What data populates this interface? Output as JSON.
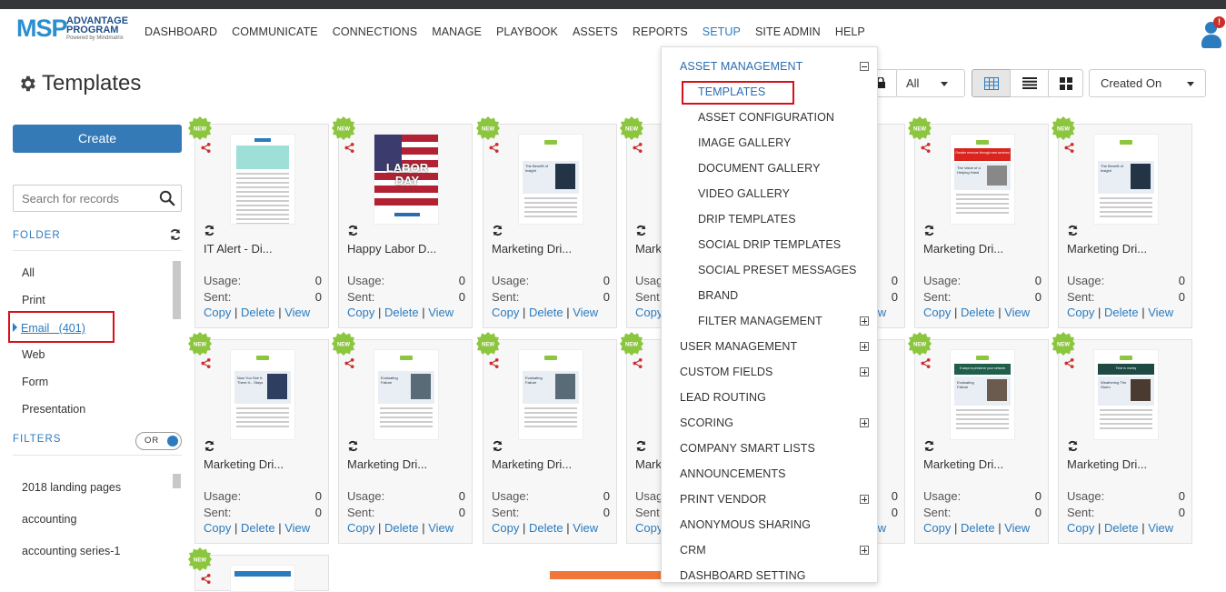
{
  "nav": {
    "logo": {
      "brand": "MSP",
      "line1": "ADVANTAGE",
      "line2": "PROGRAM",
      "powered": "Powered by Mindmatrix"
    },
    "items": [
      "DASHBOARD",
      "COMMUNICATE",
      "CONNECTIONS",
      "MANAGE",
      "PLAYBOOK",
      "ASSETS",
      "REPORTS",
      "SETUP",
      "SITE ADMIN",
      "HELP"
    ],
    "active": "SETUP",
    "notification_badge": "!"
  },
  "page": {
    "title": "Templates"
  },
  "sidebar": {
    "create_label": "Create",
    "search_placeholder": "Search for records",
    "folder_heading": "FOLDER",
    "folders": [
      "All",
      "Print",
      "Email   (401)",
      "Web",
      "Form",
      "Presentation"
    ],
    "selected_folder": "Email   (401)",
    "filters_heading": "FILTERS",
    "filter_mode": "OR",
    "filters": [
      "2018 landing pages",
      "accounting",
      "accounting series-1"
    ]
  },
  "controls": {
    "filter_value": "All",
    "sort_value": "Created On"
  },
  "cards": [
    {
      "name": "IT Alert - Di...",
      "usage_label": "Usage:",
      "usage": "0",
      "sent_label": "Sent:",
      "sent": "0"
    },
    {
      "name": "Happy Labor D...",
      "usage_label": "Usage:",
      "usage": "0",
      "sent_label": "Sent:",
      "sent": "0"
    },
    {
      "name": "Marketing Dri...",
      "usage_label": "Usage:",
      "usage": "0",
      "sent_label": "Sent:",
      "sent": "0"
    },
    {
      "name": "Mark",
      "usage_label": "Usag",
      "usage": "",
      "sent_label": "Sent",
      "sent": ""
    },
    {
      "name": "",
      "usage_label": "",
      "usage": "0",
      "sent_label": "",
      "sent": "0"
    },
    {
      "name": "Marketing Dri...",
      "usage_label": "Usage:",
      "usage": "0",
      "sent_label": "Sent:",
      "sent": "0"
    },
    {
      "name": "Marketing Dri...",
      "usage_label": "Usage:",
      "usage": "0",
      "sent_label": "Sent:",
      "sent": "0"
    },
    {
      "name": "Marketing Dri...",
      "usage_label": "Usage:",
      "usage": "0",
      "sent_label": "Sent:",
      "sent": "0"
    },
    {
      "name": "Marketing Dri...",
      "usage_label": "Usage:",
      "usage": "0",
      "sent_label": "Sent:",
      "sent": "0"
    },
    {
      "name": "Marketing Dri...",
      "usage_label": "Usage:",
      "usage": "0",
      "sent_label": "Sent:",
      "sent": "0"
    },
    {
      "name": "Mark",
      "usage_label": "Usag",
      "usage": "",
      "sent_label": "Sent",
      "sent": ""
    },
    {
      "name": "",
      "usage_label": "",
      "usage": "0",
      "sent_label": "",
      "sent": "0"
    },
    {
      "name": "Marketing Dri...",
      "usage_label": "Usage:",
      "usage": "0",
      "sent_label": "Sent:",
      "sent": "0"
    },
    {
      "name": "Marketing Dri...",
      "usage_label": "Usage:",
      "usage": "0",
      "sent_label": "Sent:",
      "sent": "0"
    }
  ],
  "card_links": {
    "copy": "Copy",
    "delete": "Delete",
    "view": "View",
    "sep": "|"
  },
  "new_badge": "NEW",
  "thumbnails": {
    "labor_day": "LABOR DAY",
    "benefit": "The Benefit of Insight",
    "value": "The Value of a Helping Hand",
    "greater": "Greater revenue through new services",
    "now_you": "Now You See It. There It... Stays",
    "evaluating": "Evaluating Failure",
    "ways": "5 ways to preserve your network",
    "time": "Time is money",
    "weathering": "Weathering The Storm"
  },
  "setup_menu": [
    {
      "label": "ASSET MANAGEMENT",
      "level": "head",
      "toggle": "minus"
    },
    {
      "label": "TEMPLATES",
      "level": "sub",
      "selected": true
    },
    {
      "label": "ASSET CONFIGURATION",
      "level": "sub"
    },
    {
      "label": "IMAGE GALLERY",
      "level": "sub"
    },
    {
      "label": "DOCUMENT GALLERY",
      "level": "sub"
    },
    {
      "label": "VIDEO GALLERY",
      "level": "sub"
    },
    {
      "label": "DRIP TEMPLATES",
      "level": "sub"
    },
    {
      "label": "SOCIAL DRIP TEMPLATES",
      "level": "sub"
    },
    {
      "label": "SOCIAL PRESET MESSAGES",
      "level": "sub"
    },
    {
      "label": "BRAND",
      "level": "sub"
    },
    {
      "label": "FILTER MANAGEMENT",
      "level": "sub",
      "toggle": "plus"
    },
    {
      "label": "USER MANAGEMENT",
      "level": "top",
      "toggle": "plus"
    },
    {
      "label": "CUSTOM FIELDS",
      "level": "top",
      "toggle": "plus"
    },
    {
      "label": "LEAD ROUTING",
      "level": "top"
    },
    {
      "label": "SCORING",
      "level": "top",
      "toggle": "plus"
    },
    {
      "label": "COMPANY SMART LISTS",
      "level": "top"
    },
    {
      "label": "ANNOUNCEMENTS",
      "level": "top"
    },
    {
      "label": "PRINT VENDOR",
      "level": "top",
      "toggle": "plus"
    },
    {
      "label": "ANONYMOUS SHARING",
      "level": "top"
    },
    {
      "label": "CRM",
      "level": "top",
      "toggle": "plus"
    },
    {
      "label": "DASHBOARD SETTING",
      "level": "top"
    }
  ],
  "colors": {
    "accent": "#2b7bbf",
    "new_badge": "#8cc63f",
    "highlight": "#d9101b",
    "share": "#c9302c"
  }
}
